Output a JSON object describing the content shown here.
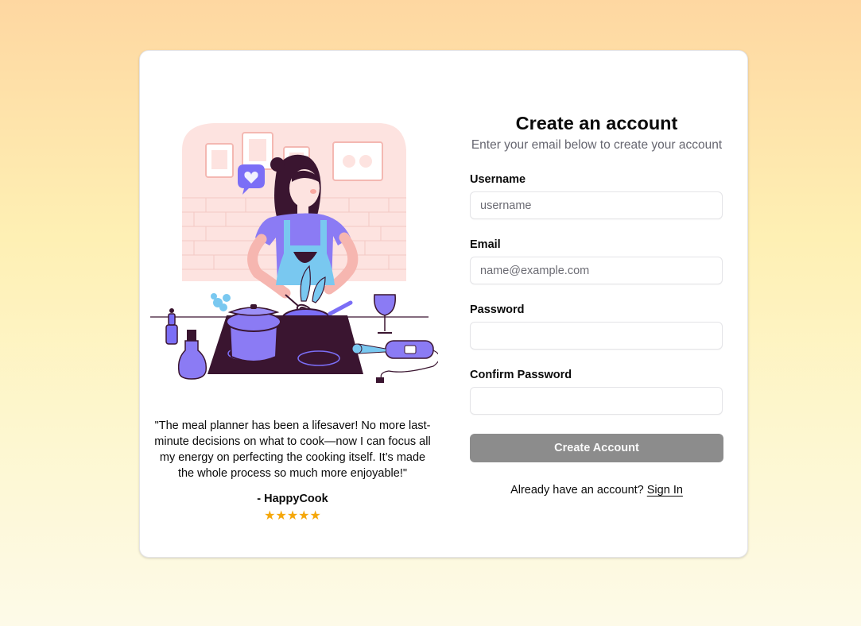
{
  "testimonial": {
    "quote": "\"The meal planner has been a lifesaver! No more last-minute decisions on what to cook—now I can focus all my energy on perfecting the cooking itself. It’s made the whole process so much more enjoyable!\"",
    "author": "- HappyCook",
    "rating": 5,
    "stars": "★★★★★"
  },
  "form": {
    "title": "Create an account",
    "subtitle": "Enter your email below to create your account",
    "fields": [
      {
        "label": "Username",
        "placeholder": "username",
        "value": ""
      },
      {
        "label": "Email",
        "placeholder": "name@example.com",
        "value": ""
      },
      {
        "label": "Password",
        "placeholder": "",
        "value": ""
      },
      {
        "label": "Confirm Password",
        "placeholder": "",
        "value": ""
      }
    ],
    "submit_label": "Create Account",
    "signin_prompt": "Already have an account?",
    "signin_link": "Sign In"
  },
  "colors": {
    "background_top": "#fed7a1",
    "background_bottom": "#fdfae8",
    "button": "#8c8c8c",
    "star": "#f5a70a",
    "illustration_purple": "#7b6ef6",
    "illustration_pink": "#fdd8d4",
    "illustration_dark": "#3a1530"
  },
  "illustration": {
    "subject": "woman-cooking-illustration"
  }
}
